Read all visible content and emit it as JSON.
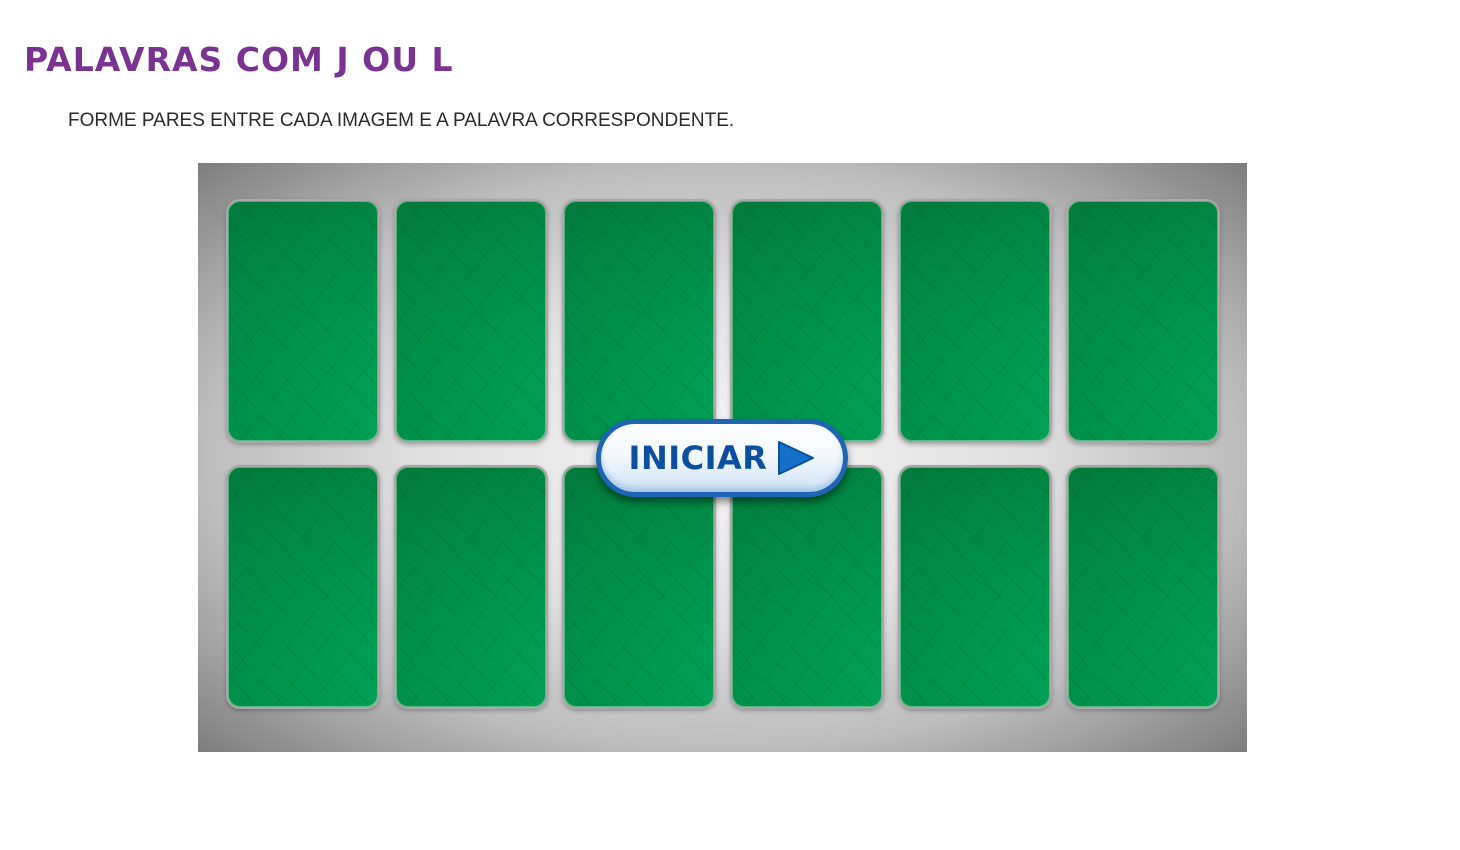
{
  "header": {
    "title": "PALAVRAS COM J OU L",
    "instructions": "FORME PARES ENTRE CADA IMAGEM E A PALAVRA CORRESPONDENTE."
  },
  "game": {
    "rows": 2,
    "columns": 6,
    "card_count": 12,
    "card_state": "face-down",
    "card_color": "#00a758",
    "start_button": {
      "label": "INICIAR",
      "icon": "play-icon"
    }
  },
  "colors": {
    "title": "#7b3391",
    "button_border": "#1e66b4",
    "button_text": "#0a4fa0"
  }
}
